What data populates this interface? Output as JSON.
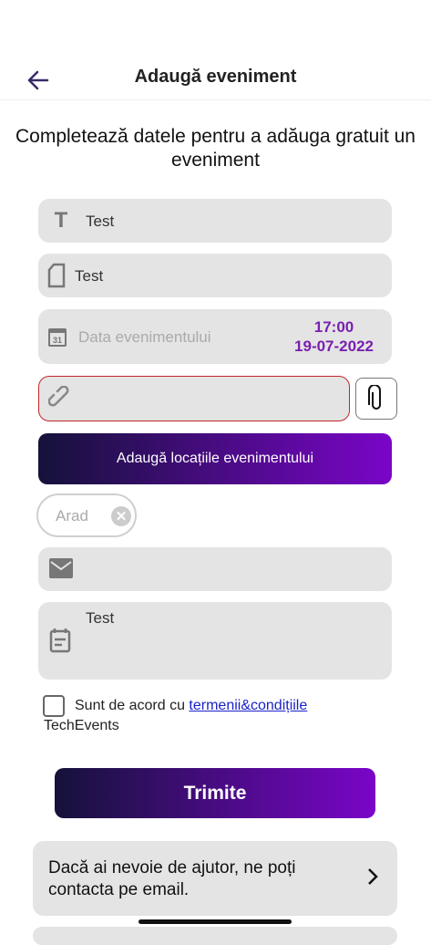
{
  "header": {
    "title": "Adaugă eveniment"
  },
  "subtitle": "Completează datele pentru a adăuga gratuit un eveniment",
  "form": {
    "name_value": "Test",
    "description_value": "Test",
    "date_placeholder": "Data evenimentului",
    "time": "17:00",
    "date": "19-07-2022",
    "link_placeholder": "",
    "add_locations_label": "Adaugă locațiile evenimentului",
    "location_chip": "Arad",
    "email_placeholder": "",
    "details_value": "Test",
    "terms_prefix": "Sunt de acord cu ",
    "terms_link": "termenii&condițiile",
    "terms_suffix": "TechEvents",
    "submit_label": "Trimite"
  },
  "help": {
    "text": "Dacă ai nevoie de ajutor, ne poți contacta pe email."
  },
  "colors": {
    "accent": "#7a05c8",
    "dark": "#15123a",
    "error": "#c0262c"
  }
}
